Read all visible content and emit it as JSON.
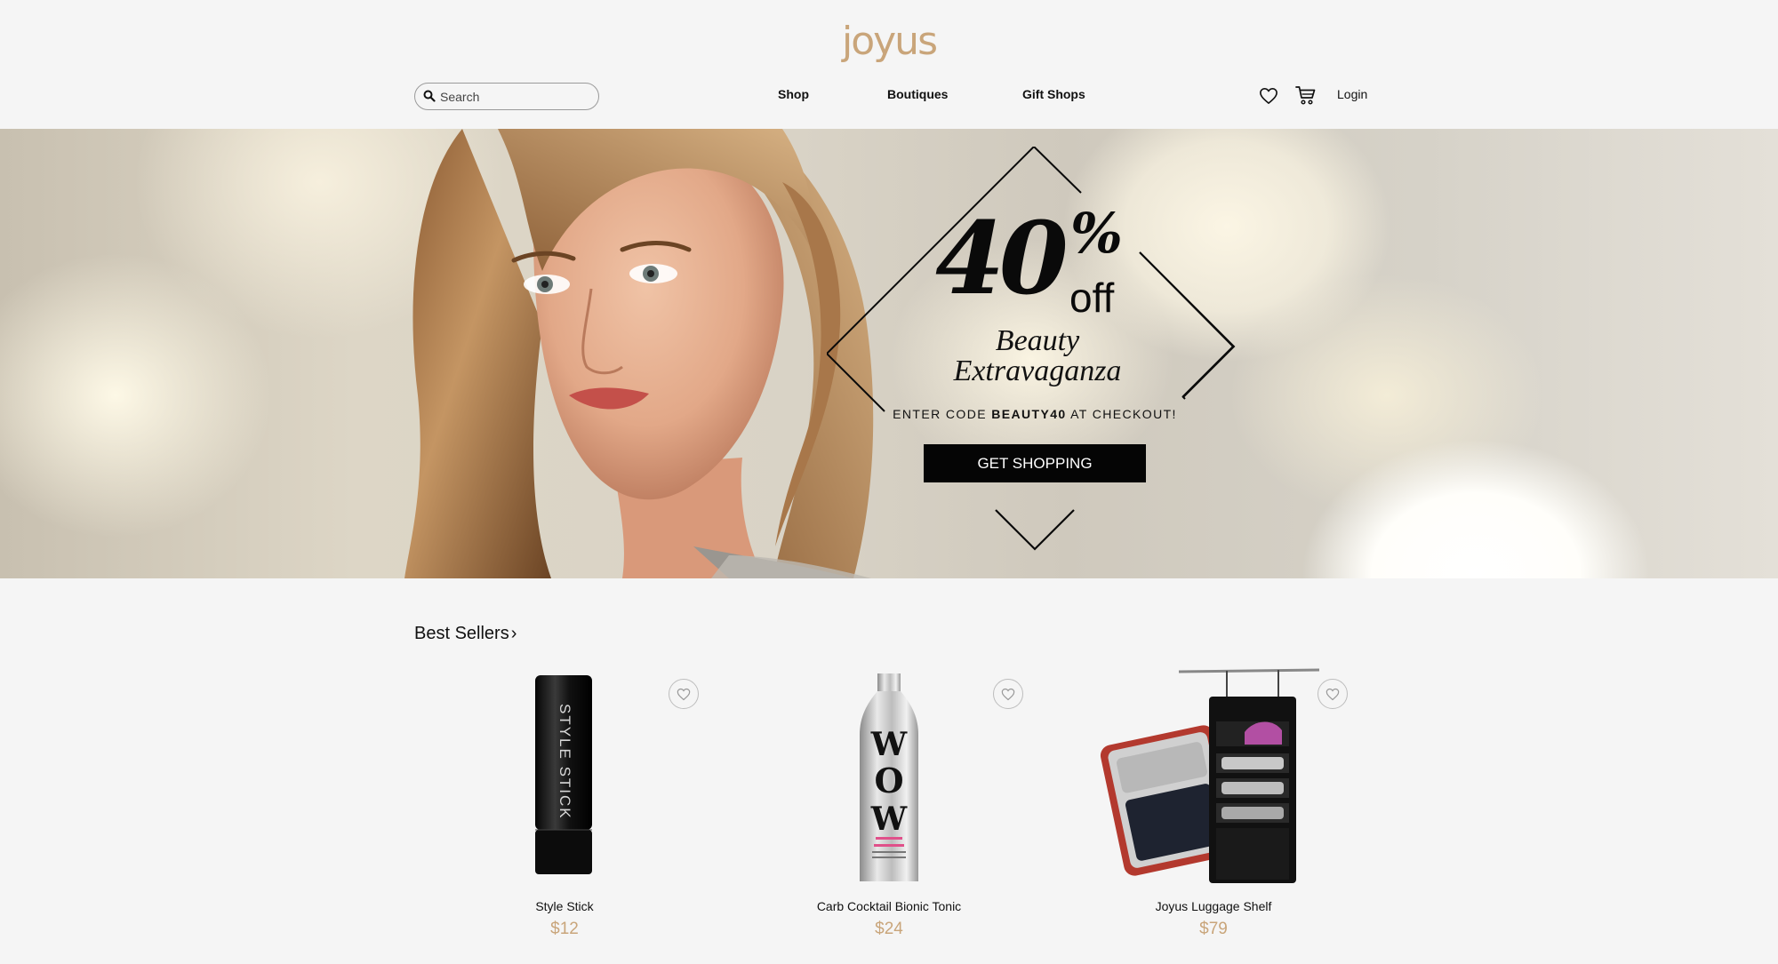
{
  "brand": {
    "logo_text": "joyus",
    "accent_color": "#c9a57a"
  },
  "header": {
    "search": {
      "placeholder": "Search",
      "icon": "search-icon"
    },
    "nav": [
      {
        "label": "Shop"
      },
      {
        "label": "Boutiques"
      },
      {
        "label": "Gift Shops"
      }
    ],
    "wishlist_icon": "heart-icon",
    "cart_icon": "cart-icon",
    "login_label": "Login"
  },
  "hero": {
    "discount_number": "40",
    "discount_percent": "%",
    "discount_off": "off",
    "title_line1": "Beauty",
    "title_line2": "Extravaganza",
    "code_prefix": "ENTER CODE ",
    "code": "BEAUTY40",
    "code_suffix": " AT CHECKOUT!",
    "cta_label": "GET SHOPPING"
  },
  "best_sellers": {
    "title": "Best Sellers",
    "chevron": "›",
    "products": [
      {
        "name": "Style Stick",
        "price": "$12",
        "image_text": "STYLE STICK"
      },
      {
        "name": "Carb Cocktail Bionic Tonic",
        "price": "$24",
        "image_text": "WOW"
      },
      {
        "name": "Joyus Luggage Shelf",
        "price": "$79",
        "image_text": ""
      }
    ]
  }
}
